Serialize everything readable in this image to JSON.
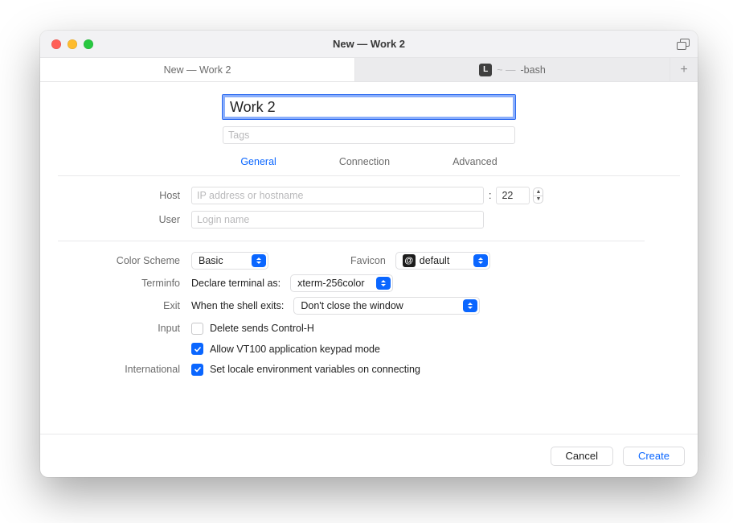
{
  "titlebar": {
    "title": "New — Work 2"
  },
  "tabs": {
    "active": {
      "label": "New — Work 2"
    },
    "inactive": {
      "badge": "L",
      "dim": "~ —",
      "label": "-bash"
    }
  },
  "form": {
    "name_value": "Work 2",
    "tags_placeholder": "Tags",
    "section_tabs": {
      "general": "General",
      "connection": "Connection",
      "advanced": "Advanced"
    },
    "host": {
      "label": "Host",
      "placeholder": "IP address or hostname",
      "port_value": "22"
    },
    "user": {
      "label": "User",
      "placeholder": "Login name"
    },
    "color_scheme": {
      "label": "Color Scheme",
      "value": "Basic"
    },
    "favicon": {
      "label": "Favicon",
      "badge": "@",
      "value": "default"
    },
    "terminfo": {
      "label": "Terminfo",
      "text": "Declare terminal as:",
      "value": "xterm-256color"
    },
    "exit": {
      "label": "Exit",
      "text": "When the shell exits:",
      "value": "Don't close the window"
    },
    "input": {
      "label": "Input",
      "opt_delete": "Delete sends Control-H",
      "opt_vt100": "Allow VT100 application keypad mode"
    },
    "international": {
      "label": "International",
      "opt_locale": "Set locale environment variables on connecting"
    }
  },
  "footer": {
    "cancel": "Cancel",
    "create": "Create"
  }
}
